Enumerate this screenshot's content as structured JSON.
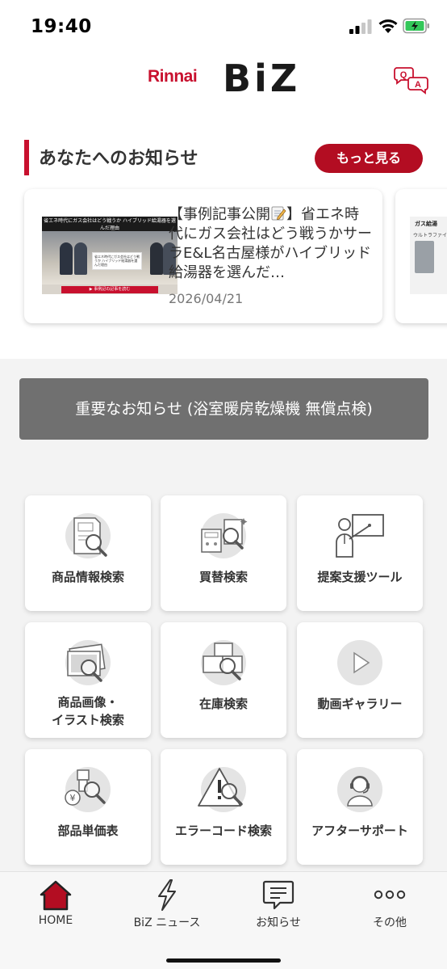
{
  "status_bar": {
    "time": "19:40"
  },
  "header": {
    "brand": "Rinnai",
    "app_name": "BiZ",
    "qa_label_q": "Q",
    "qa_label_a": "A"
  },
  "notices": {
    "section_title": "あなたへのお知らせ",
    "more_label": "もっと見る",
    "cards": [
      {
        "title_prefix": "【事例記事公開",
        "title_rest": "】省エネ時代にガス会社はどう戦うかサーラE&L名古屋様がハイブリッド給湯器を選んだ…",
        "date": "2026/04/21",
        "thumb_headline": "省エネ時代にガス会社はどう戦うか ハイブリッド給湯器を選んだ理由",
        "thumb_panel": "省エネ時代にガス会社はどう戦うか ハイブリッド給湯器を選んだ理由",
        "thumb_cta": "▶ 事例記の記事を読む"
      },
      {
        "thumb_title": "ガス給湯",
        "thumb_sub": "ウルトラファイン"
      }
    ]
  },
  "important_banner": "重要なお知らせ (浴室暖房乾燥機 無償点検)",
  "menu": {
    "tiles": [
      {
        "label": "商品情報検索",
        "icon": "product-search-icon"
      },
      {
        "label": "買替検索",
        "icon": "replacement-search-icon"
      },
      {
        "label": "提案支援ツール",
        "icon": "presentation-icon"
      },
      {
        "label_line1": "商品画像・",
        "label_line2": "イラスト検索",
        "icon": "image-search-icon"
      },
      {
        "label": "在庫検索",
        "icon": "stock-search-icon"
      },
      {
        "label": "動画ギャラリー",
        "icon": "video-play-icon"
      },
      {
        "label": "部品単価表",
        "icon": "parts-price-icon"
      },
      {
        "label": "エラーコード検索",
        "icon": "error-code-icon"
      },
      {
        "label": "アフターサポート",
        "icon": "support-headset-icon"
      }
    ]
  },
  "bottom_nav": {
    "items": [
      {
        "label": "HOME",
        "icon": "home-icon"
      },
      {
        "label": "BiZ ニュース",
        "icon": "lightning-icon"
      },
      {
        "label": "お知らせ",
        "icon": "message-icon"
      },
      {
        "label": "その他",
        "icon": "more-dots-icon"
      }
    ]
  },
  "colors": {
    "accent": "#c8102e",
    "banner": "#707070",
    "background_grey": "#f3f3f3"
  }
}
